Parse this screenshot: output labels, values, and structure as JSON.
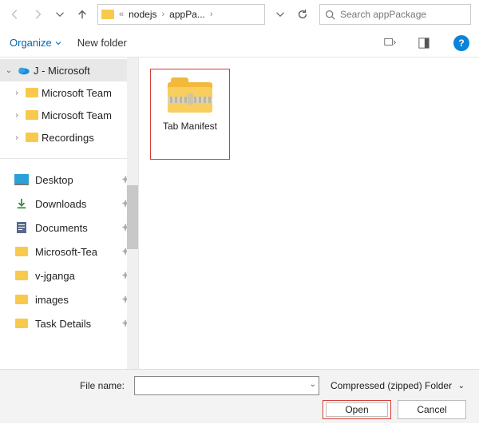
{
  "breadcrumb": {
    "sep": "«",
    "p1": "nodejs",
    "gt": "›",
    "p2": "appPa...",
    "gt2": "›"
  },
  "search": {
    "placeholder": "Search appPackage"
  },
  "cmdbar": {
    "organize": "Organize",
    "newfolder": "New folder"
  },
  "tree": {
    "root": "J - Microsoft",
    "children": [
      "Microsoft Team",
      "Microsoft Team",
      "Recordings"
    ]
  },
  "quick": [
    "Desktop",
    "Downloads",
    "Documents",
    "Microsoft-Tea",
    "v-jganga",
    "images",
    "Task Details"
  ],
  "item": {
    "label": "Tab Manifest"
  },
  "footer": {
    "label": "File name:",
    "value": "",
    "type": "Compressed (zipped) Folder",
    "open": "Open",
    "cancel": "Cancel"
  }
}
